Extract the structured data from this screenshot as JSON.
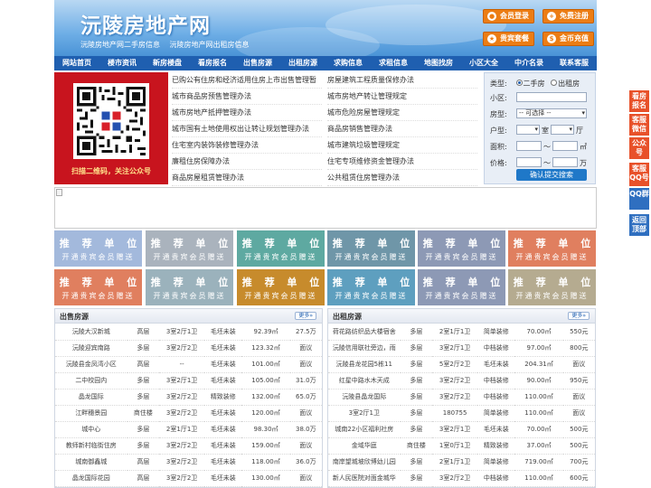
{
  "header": {
    "title": "沅陵房地产网",
    "subtitles": [
      "沅陵房地产网二手房信息",
      "沅陵房地产网出租房信息"
    ],
    "buttons": [
      {
        "label": "会员登录",
        "icon": "user-icon"
      },
      {
        "label": "免费注册",
        "icon": "register-icon"
      },
      {
        "label": "贵宾套餐",
        "icon": "vip-icon"
      },
      {
        "label": "金币充值",
        "icon": "coin-icon"
      }
    ],
    "accent": "#ec7d14"
  },
  "nav": [
    "网站首页",
    "楼市资讯",
    "新房楼盘",
    "看房报名",
    "出售房源",
    "出租房源",
    "求购信息",
    "求租信息",
    "地图找房",
    "小区大全",
    "中介名录",
    "联系客服"
  ],
  "qr": {
    "caption": "扫描二维码，关注公众号"
  },
  "policy_left": [
    "已购公有住房和经济适用住房上市出售管理暂",
    "城市商品房预售管理办法",
    "城市房地产抵押管理办法",
    "城市国有土地使用权出让转让规划管理办法",
    "住宅室内装饰装修管理办法",
    "廉租住房保障办法",
    "商品房屋租赁管理办法"
  ],
  "policy_right": [
    "房屋建筑工程质量保修办法",
    "城市房地产转让管理规定",
    "城市危险房屋管理规定",
    "商品房销售管理办法",
    "城市建筑垃圾管理规定",
    "住宅专项维修资金管理办法",
    "公共租赁住房管理办法"
  ],
  "search": {
    "type_label": "类型:",
    "type_options": [
      "二手房",
      "出租房"
    ],
    "community_label": "小区:",
    "housetype_label": "房型:",
    "housetype_value": "-- 可选择 --",
    "layout_label": "户型:",
    "room_unit": "室",
    "hall_unit": "厅",
    "area_label": "面积:",
    "area_unit": "㎡",
    "price_label": "价格:",
    "price_unit": "万",
    "range_sep": "～",
    "submit": "确认提交搜索"
  },
  "tiles": {
    "title": "推 荐 单 位",
    "subtitle": "开通贵宾会员赠送",
    "colors": [
      "#a3b9dc",
      "#aab3bd",
      "#5ea9a1",
      "#6f96a8",
      "#8d99b5",
      "#e07f5f",
      "#e07f5f",
      "#9bb2bc",
      "#c78b2c",
      "#5e9fbf",
      "#8d99b5",
      "#b5ab90"
    ]
  },
  "sale": {
    "title": "出售房源",
    "more": "更多»",
    "rows": [
      [
        "沅陵大汉新城",
        "高层",
        "3室2厅1卫",
        "毛坯未装",
        "92.39㎡",
        "27.5万"
      ],
      [
        "沅陵迎宾南路",
        "多层",
        "3室2厅2卫",
        "毛坯未装",
        "123.32㎡",
        "面议"
      ],
      [
        "沅陵县金凤湾小区",
        "高层",
        "--",
        "毛坯未装",
        "101.00㎡",
        "面议"
      ],
      [
        "二中校园内",
        "多层",
        "3室2厅1卫",
        "毛坯未装",
        "105.00㎡",
        "31.0万"
      ],
      [
        "晶龙国际",
        "多层",
        "3室2厅2卫",
        "精致装修",
        "132.00㎡",
        "65.0万"
      ],
      [
        "江畔穗景园",
        "商住楼",
        "3室2厅2卫",
        "毛坯未装",
        "120.00㎡",
        "面议"
      ],
      [
        "城中心",
        "多层",
        "2室1厅1卫",
        "毛坯未装",
        "98.30㎡",
        "38.0万"
      ],
      [
        "教师新村临街住房",
        "多层",
        "3室2厅2卫",
        "毛坯未装",
        "159.00㎡",
        "面议"
      ],
      [
        "城南御鑫城",
        "高层",
        "3室2厅2卫",
        "毛坯未装",
        "118.00㎡",
        "36.0万"
      ],
      [
        "晶龙国际花园",
        "高层",
        "3室2厅2卫",
        "毛坯未装",
        "130.00㎡",
        "面议"
      ]
    ]
  },
  "rent": {
    "title": "出租房源",
    "more": "更多»",
    "rows": [
      [
        "荷花路纺织品大楼宿舍",
        "多层",
        "2室1厅1卫",
        "简单装修",
        "70.00㎡",
        "550元"
      ],
      [
        "沅陵信用联社旁边，雨",
        "多层",
        "3室2厅1卫",
        "中档装修",
        "97.00㎡",
        "800元"
      ],
      [
        "沅陵县龙花园5栋11",
        "多层",
        "5室2厅2卫",
        "毛坯未装",
        "204.31㎡",
        "面议"
      ],
      [
        "红星中路水木天成",
        "多层",
        "3室2厅2卫",
        "中档装修",
        "90.00㎡",
        "950元"
      ],
      [
        "沅陵县晶龙国际",
        "多层",
        "3室2厅2卫",
        "中档装修",
        "110.00㎡",
        "面议"
      ],
      [
        "3室2厅1卫",
        "多层",
        "180755",
        "简单装修",
        "110.00㎡",
        "面议"
      ],
      [
        "城南22小区福利社房",
        "多层",
        "3室2厅1卫",
        "毛坯未装",
        "70.00㎡",
        "500元"
      ],
      [
        "金域华庭",
        "商住楼",
        "1室0厅1卫",
        "精致装修",
        "37.00㎡",
        "500元"
      ],
      [
        "南岸望城坡欣博幼儿园",
        "多层",
        "2室1厅1卫",
        "简单装修",
        "719.00㎡",
        "700元"
      ],
      [
        "新人民医院对面金城华",
        "多层",
        "3室2厅2卫",
        "中档装修",
        "110.00㎡",
        "600元"
      ]
    ]
  },
  "float": [
    "看房报名",
    "客服微信",
    "公众号",
    "客服QQ号",
    "QQ群",
    "返回顶部"
  ]
}
